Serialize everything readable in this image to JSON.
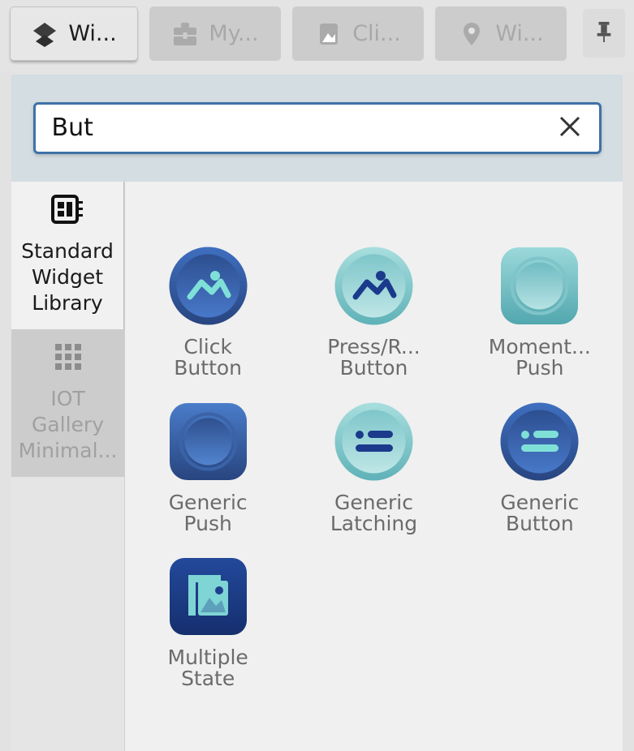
{
  "tabs": [
    {
      "label": "Wi...",
      "icon": "layers-icon",
      "active": true
    },
    {
      "label": "My...",
      "icon": "briefcase-icon",
      "active": false
    },
    {
      "label": "Cli...",
      "icon": "image-icon",
      "active": false
    },
    {
      "label": "Wi...",
      "icon": "map-pin-icon",
      "active": false
    }
  ],
  "pin_button": {
    "icon": "pushpin-icon",
    "label": ""
  },
  "search": {
    "value": "But",
    "placeholder": "",
    "clear_icon": "close-icon"
  },
  "sidebar": {
    "items": [
      {
        "label": "Standard Widget Library",
        "icon": "widget-library-icon",
        "active": true
      },
      {
        "label": "IOT Gallery Minimal...",
        "icon": "grid-dots-icon",
        "active": false
      }
    ]
  },
  "colors": {
    "accent_blue": "#3f72a8",
    "search_strip": "#d4dde1",
    "content_bg": "#f0f0f0",
    "tab_inactive": "#cccccc",
    "tab_active": "#e7e7e7",
    "widget_dark_blue": "#2f5ba5",
    "widget_teal": "#8fd2d4",
    "widget_navy": "#1b3a7a",
    "label_grey": "#6b6b6b"
  },
  "widgets": [
    {
      "label": "Click\nButton",
      "style": "round-blue-image",
      "icon": "image-mountain-icon"
    },
    {
      "label": "Press/R...\nButton",
      "style": "round-teal-image",
      "icon": "image-mountain-icon"
    },
    {
      "label": "Moment...\nPush",
      "style": "square-teal-push",
      "icon": "concentric-circle-icon"
    },
    {
      "label": "Generic\nPush",
      "style": "square-blue-push",
      "icon": "concentric-circle-icon"
    },
    {
      "label": "Generic\nLatching",
      "style": "round-teal-list",
      "icon": "list-bars-icon"
    },
    {
      "label": "Generic\nButton",
      "style": "round-blue-list",
      "icon": "list-bars-icon"
    },
    {
      "label": "Multiple\nState",
      "style": "square-navy-stack",
      "icon": "stacked-images-icon"
    }
  ]
}
